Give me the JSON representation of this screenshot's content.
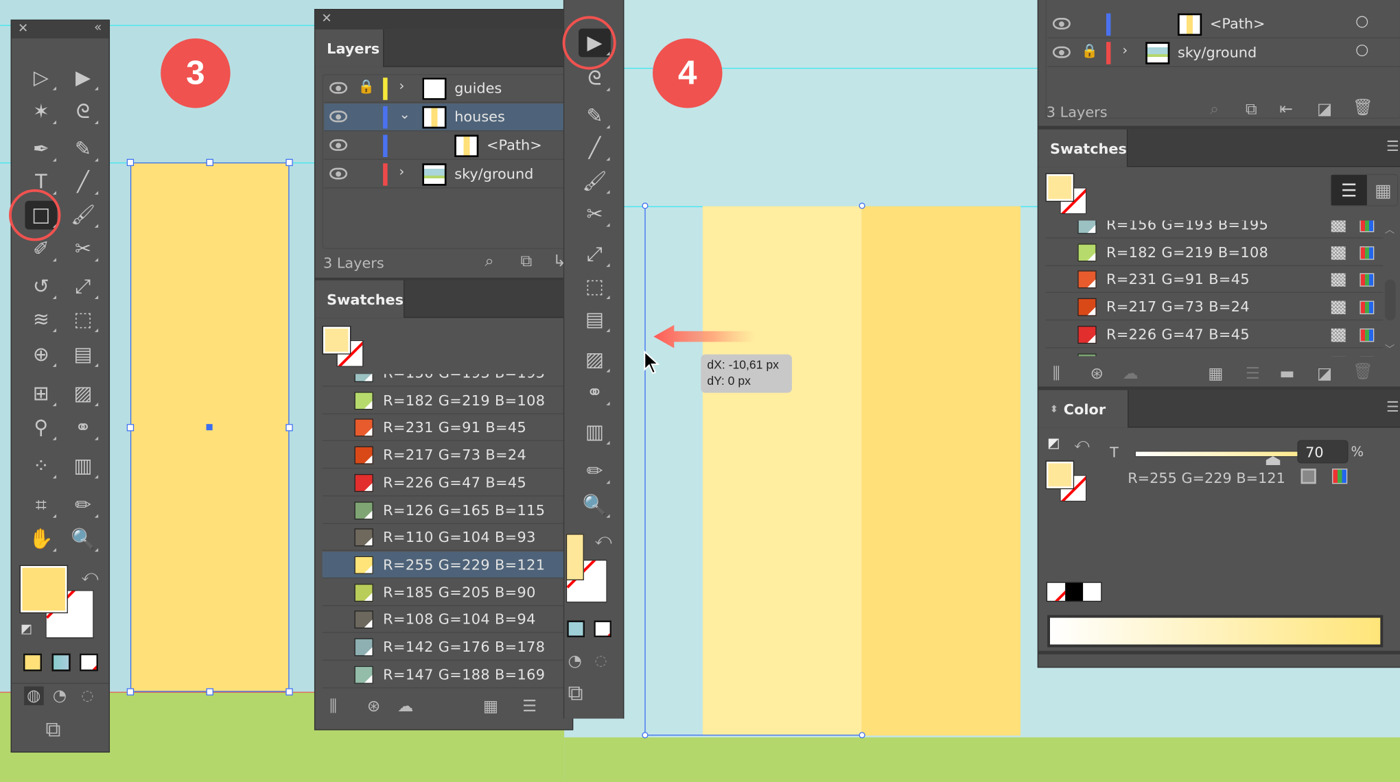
{
  "steps": [
    "3",
    "4"
  ],
  "toolbar": {
    "tools": [
      [
        "selection-tool",
        "direct-selection-tool"
      ],
      [
        "magic-wand-tool",
        "lasso-tool"
      ],
      [
        "pen-tool",
        "curvature-tool"
      ],
      [
        "type-tool",
        "line-segment-tool"
      ],
      [
        "rectangle-tool",
        "paintbrush-tool"
      ],
      [
        "shaper-tool",
        "scissors-tool"
      ],
      [
        "rotate-tool",
        "scale-tool"
      ],
      [
        "warp-tool",
        "free-transform-tool"
      ],
      [
        "shape-builder-tool",
        "perspective-grid-tool"
      ],
      [
        "mesh-tool",
        "gradient-tool"
      ],
      [
        "eyedropper-tool",
        "blend-tool"
      ],
      [
        "symbol-sprayer-tool",
        "column-graph-tool"
      ],
      [
        "artboard-tool",
        "slice-tool"
      ],
      [
        "hand-tool",
        "zoom-tool"
      ]
    ],
    "active_tool": "rectangle-tool",
    "fill_color": "#ffe079"
  },
  "layers": {
    "tab": "Layers",
    "count_label": "3 Layers",
    "rows": [
      {
        "name": "guides",
        "color": "#f5e83a",
        "locked": true,
        "expanded": false,
        "thumb": "blank"
      },
      {
        "name": "houses",
        "color": "#4a72f0",
        "locked": false,
        "expanded": true,
        "selected": true,
        "thumb": "house"
      },
      {
        "name": "<Path>",
        "color": "#4a72f0",
        "child": true,
        "thumb": "house"
      },
      {
        "name": "sky/ground",
        "color": "#ef4a4a",
        "expanded": false,
        "thumb": "sky"
      }
    ]
  },
  "right_layers": {
    "count_label": "3 Layers",
    "rows": [
      {
        "name": "<Path>",
        "color": "#4a72f0",
        "child": true,
        "thumb": "house"
      },
      {
        "name": "sky/ground",
        "color": "#ef4a4a",
        "locked": true,
        "thumb": "sky"
      }
    ]
  },
  "swatches": {
    "tab": "Swatches",
    "items": [
      {
        "label": "R=156 G=193 B=195",
        "color": "#9cc1c3"
      },
      {
        "label": "R=182 G=219 B=108",
        "color": "#b6db6c"
      },
      {
        "label": "R=231 G=91 B=45",
        "color": "#e75b2d"
      },
      {
        "label": "R=217 G=73 B=24",
        "color": "#d94918"
      },
      {
        "label": "R=226 G=47 B=45",
        "color": "#e22f2d"
      },
      {
        "label": "R=126 G=165 B=115",
        "color": "#7ea573"
      },
      {
        "label": "R=110 G=104 B=93",
        "color": "#6e685d"
      },
      {
        "label": "R=255 G=229 B=121",
        "color": "#ffe579",
        "selected": true
      },
      {
        "label": "R=185 G=205 B=90",
        "color": "#b9cd5a"
      },
      {
        "label": "R=108 G=104 B=94",
        "color": "#6c685e"
      },
      {
        "label": "R=142 G=176 B=178",
        "color": "#8eb0b2"
      },
      {
        "label": "R=147 G=188 B=169",
        "color": "#93bca9"
      }
    ]
  },
  "color_panel": {
    "tab": "Color",
    "tint_label": "T",
    "tint_value": "70",
    "tint_unit": "%",
    "tint_percent": 70,
    "rgb_label": "R=255 G=229 B=121",
    "base_color": "#ffe579"
  },
  "tooltip": {
    "dx": "dX: -10,61 px",
    "dy": "dY: 0 px"
  },
  "colors": {
    "house_original": "#ffe079",
    "house_tint": "#ffeda0",
    "sky": "#b7dfe3",
    "ground": "#b4d76b",
    "step_badge": "#f0524f",
    "selection": "#3b6ef0"
  }
}
